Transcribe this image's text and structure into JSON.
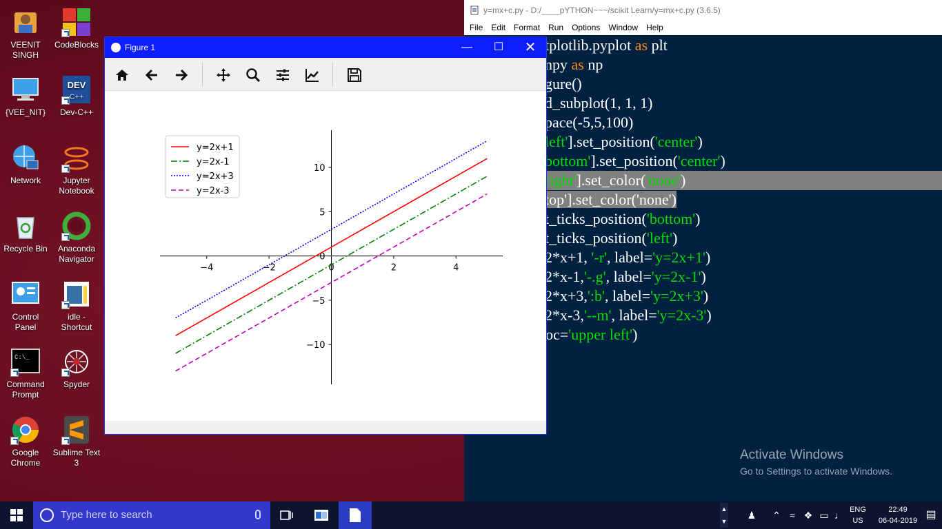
{
  "desktop": {
    "icons": [
      {
        "label": "VEENIT SINGH",
        "icon": "user-folder-icon"
      },
      {
        "label": "CodeBlocks",
        "icon": "codeblocks-icon"
      },
      {
        "label": "{VEE_NIT}",
        "icon": "computer-icon"
      },
      {
        "label": "Dev-C++",
        "icon": "devcpp-icon"
      },
      {
        "label": "Network",
        "icon": "network-icon"
      },
      {
        "label": "Jupyter Notebook",
        "icon": "jupyter-icon"
      },
      {
        "label": "Recycle Bin",
        "icon": "recycle-bin-icon"
      },
      {
        "label": "Anaconda Navigator",
        "icon": "anaconda-icon"
      },
      {
        "label": "Control Panel",
        "icon": "control-panel-icon"
      },
      {
        "label": "idle - Shortcut",
        "icon": "idle-icon"
      },
      {
        "label": "Command Prompt",
        "icon": "cmd-icon"
      },
      {
        "label": "Spyder",
        "icon": "spyder-icon"
      },
      {
        "label": "Google Chrome",
        "icon": "chrome-icon"
      },
      {
        "label": "Sublime Text 3",
        "icon": "sublime-icon"
      }
    ]
  },
  "idle": {
    "title": "y=mx+c.py - D:/____pYTHON~~~/scikit Learn/y=mx+c.py (3.6.5)",
    "menu": [
      "File",
      "Edit",
      "Format",
      "Run",
      "Options",
      "Window",
      "Help"
    ],
    "code_lines": [
      [
        {
          "t": "tplotlib.pyplot "
        },
        {
          "t": "as",
          "c": "kw"
        },
        {
          "t": " plt"
        }
      ],
      [
        {
          "t": "npy "
        },
        {
          "t": "as",
          "c": "kw"
        },
        {
          "t": " np"
        }
      ],
      [
        {
          "t": "gure()"
        }
      ],
      [
        {
          "t": "d_subplot(1, 1, 1)"
        }
      ],
      [
        {
          "t": "pace(-5,5,100)"
        }
      ],
      [
        {
          "t": "left'",
          "c": "st"
        },
        {
          "t": "].set_position("
        },
        {
          "t": "'center'",
          "c": "st"
        },
        {
          "t": ")"
        }
      ],
      [
        {
          "t": "bottom'",
          "c": "st"
        },
        {
          "t": "].set_position("
        },
        {
          "t": "'center'",
          "c": "st"
        },
        {
          "t": ")"
        }
      ],
      [
        {
          "t": "right'",
          "c": "st"
        },
        {
          "t": "].set_color("
        },
        {
          "t": "'none'",
          "c": "st"
        },
        {
          "t": ")"
        }
      ],
      [
        {
          "t": "top'].set_color('none')"
        }
      ],
      [
        {
          "t": "t_ticks_position("
        },
        {
          "t": "'bottom'",
          "c": "st"
        },
        {
          "t": ")"
        }
      ],
      [
        {
          "t": "t_ticks_position("
        },
        {
          "t": "'left'",
          "c": "st"
        },
        {
          "t": ")"
        }
      ],
      [
        {
          "t": "2*x+1, "
        },
        {
          "t": "'-r'",
          "c": "st"
        },
        {
          "t": ", label="
        },
        {
          "t": "'y=2x+1'",
          "c": "st"
        },
        {
          "t": ")"
        }
      ],
      [
        {
          "t": "2*x-1,"
        },
        {
          "t": "'-.g'",
          "c": "st"
        },
        {
          "t": ", label="
        },
        {
          "t": "'y=2x-1'",
          "c": "st"
        },
        {
          "t": ")"
        }
      ],
      [
        {
          "t": "2*x+3,"
        },
        {
          "t": "':b'",
          "c": "st"
        },
        {
          "t": ", label="
        },
        {
          "t": "'y=2x+3'",
          "c": "st"
        },
        {
          "t": ")"
        }
      ],
      [
        {
          "t": "2*x-3,"
        },
        {
          "t": "'--m'",
          "c": "st"
        },
        {
          "t": ", label="
        },
        {
          "t": "'y=2x-3'",
          "c": "st"
        },
        {
          "t": ")"
        }
      ],
      [
        {
          "t": "loc="
        },
        {
          "t": "'upper left'",
          "c": "st"
        },
        {
          "t": ")"
        }
      ]
    ],
    "activate_title": "Activate Windows",
    "activate_sub": "Go to Settings to activate Windows."
  },
  "figure": {
    "title": "Figure 1",
    "toolbar": [
      "home-icon",
      "back-arrow-icon",
      "forward-arrow-icon",
      "pan-icon",
      "zoom-icon",
      "subplots-config-icon",
      "edit-axis-icon",
      "save-icon"
    ]
  },
  "chart_data": {
    "type": "line",
    "title": "",
    "xlabel": "",
    "ylabel": "",
    "xlim": [
      -5.5,
      5.5
    ],
    "ylim": [
      -14.5,
      14.2
    ],
    "xticks": [
      -4,
      -2,
      0,
      2,
      4
    ],
    "yticks": [
      -10,
      -5,
      0,
      5,
      10
    ],
    "x": [
      -5,
      5
    ],
    "series": [
      {
        "name": "y=2x+1",
        "slope": 2,
        "intercept": 1,
        "values": [
          -9,
          11
        ],
        "color": "#ff0000",
        "dash": "solid"
      },
      {
        "name": "y=2x-1",
        "slope": 2,
        "intercept": -1,
        "values": [
          -11,
          9
        ],
        "color": "#008000",
        "dash": "dashdot"
      },
      {
        "name": "y=2x+3",
        "slope": 2,
        "intercept": 3,
        "values": [
          -7,
          13
        ],
        "color": "#0000ff",
        "dash": "dotted"
      },
      {
        "name": "y=2x-3",
        "slope": 2,
        "intercept": -3,
        "values": [
          -13,
          7
        ],
        "color": "#bf00bf",
        "dash": "dashed"
      }
    ],
    "legend": "upper left",
    "grid": false
  },
  "taskbar": {
    "search_placeholder": "Type here to search",
    "lang_top": "ENG",
    "lang_bottom": "US",
    "time": "22:49",
    "date": "06-04-2019"
  }
}
